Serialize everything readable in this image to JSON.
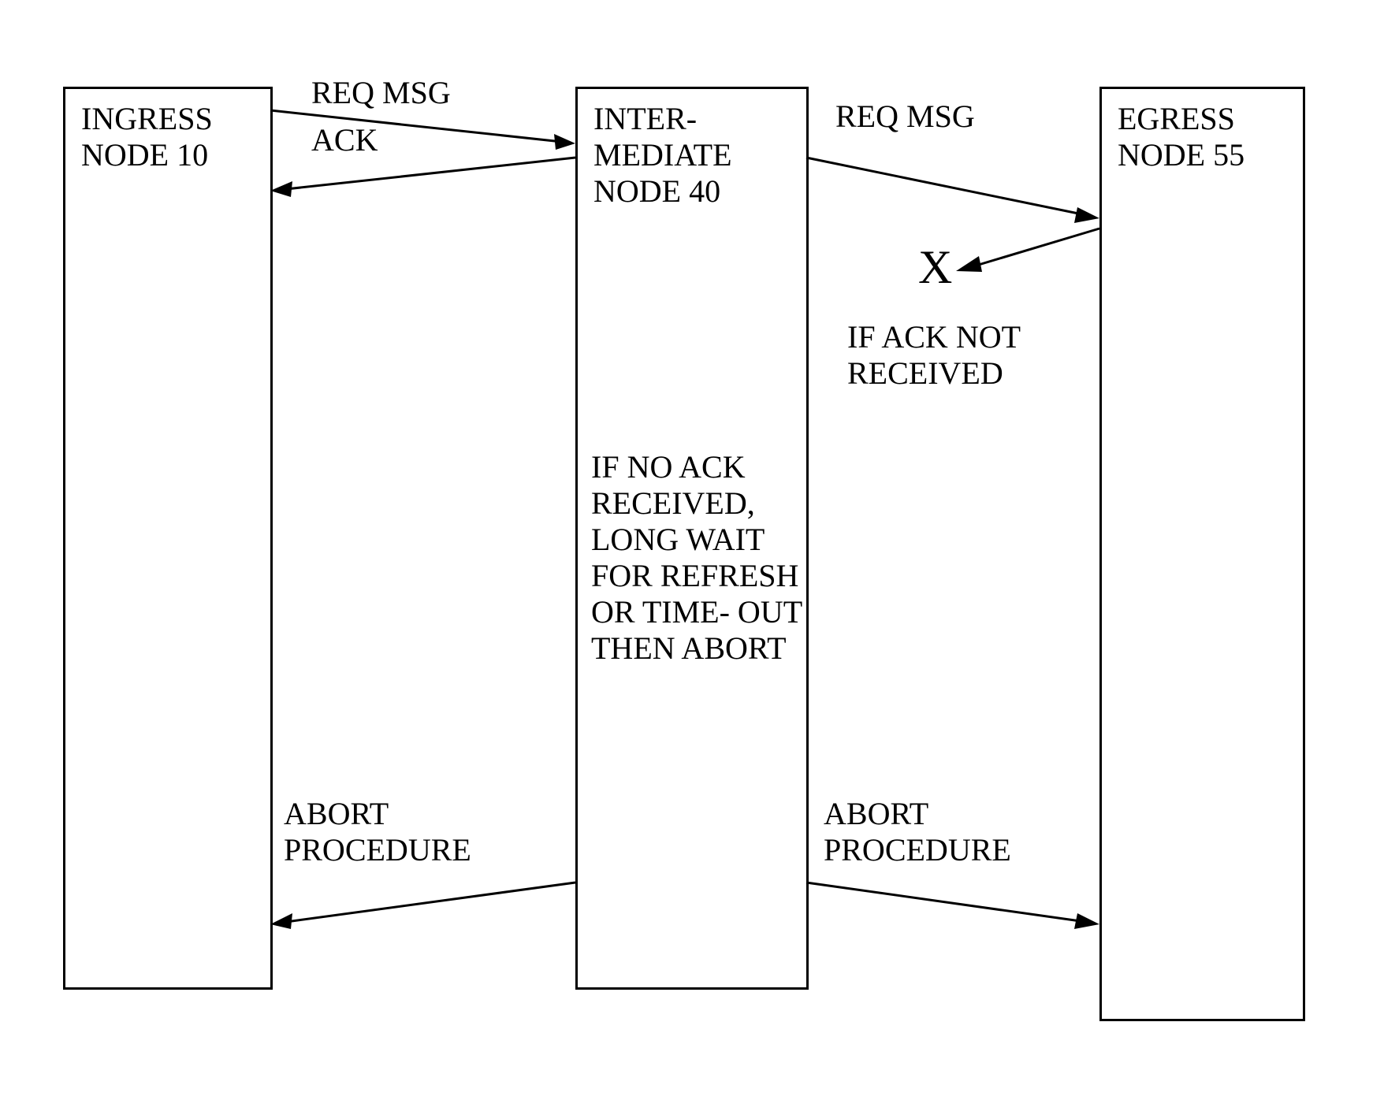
{
  "nodes": {
    "ingress": "INGRESS NODE 10",
    "intermediate": "INTER- MEDIATE NODE 40",
    "egress": "EGRESS NODE 55"
  },
  "messages": {
    "req_msg_left": "REQ MSG",
    "ack_left": "ACK",
    "req_msg_right": "REQ MSG",
    "x_mark": "X",
    "if_ack_not_received": "IF ACK NOT RECEIVED",
    "if_no_ack": "IF NO ACK RECEIVED, LONG WAIT FOR REFRESH OR TIME- OUT THEN ABORT",
    "abort_left": "ABORT PROCEDURE",
    "abort_right": "ABORT PROCEDURE"
  }
}
